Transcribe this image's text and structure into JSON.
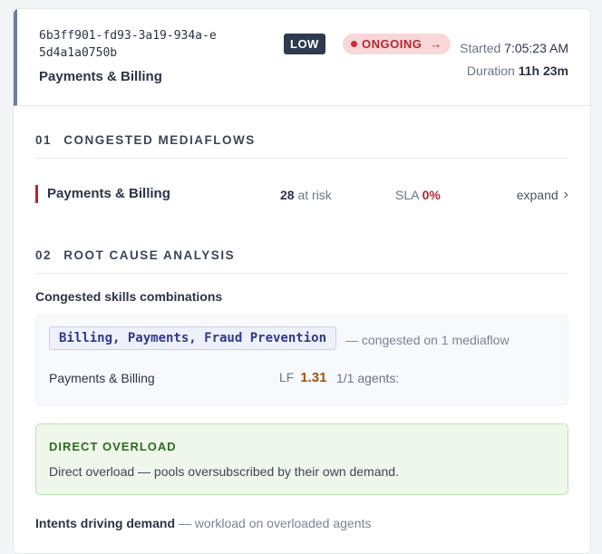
{
  "incident": {
    "id": "6b3ff901-fd93-3a19-934a-e5d4a1a0750b",
    "queue": "Payments & Billing",
    "severity": "LOW",
    "status": "ONGOING",
    "started_label": "Started",
    "started_value": "7:05:23 AM",
    "duration_label": "Duration",
    "duration_value": "11h 23m"
  },
  "sections": {
    "congested": {
      "num": "01",
      "title": "CONGESTED MEDIAFLOWS"
    },
    "root_cause": {
      "num": "02",
      "title": "ROOT CAUSE ANALYSIS"
    }
  },
  "mediaflow": {
    "name": "Payments & Billing",
    "risk_count": "28",
    "risk_label": "at risk",
    "sla_label": "SLA",
    "sla_value": "0%",
    "expand_label": "expand"
  },
  "rca": {
    "combos_heading": "Congested skills combinations",
    "skills_chip": "Billing, Payments, Fraud Prevention",
    "combo_note": "— congested on 1 mediaflow",
    "combo_queue": "Payments & Billing",
    "lf_label": "LF",
    "lf_value": "1.31",
    "agents": "1/1 agents:"
  },
  "overload": {
    "title": "DIRECT OVERLOAD",
    "text": "Direct overload — pools oversubscribed by their own demand."
  },
  "intents": {
    "heading": "Intents driving demand",
    "note": "— workload on overloaded agents"
  },
  "colors": {
    "accent_red": "#b3262f",
    "severity_bg": "#2e3a4e",
    "overload_green": "#2f6a23"
  }
}
